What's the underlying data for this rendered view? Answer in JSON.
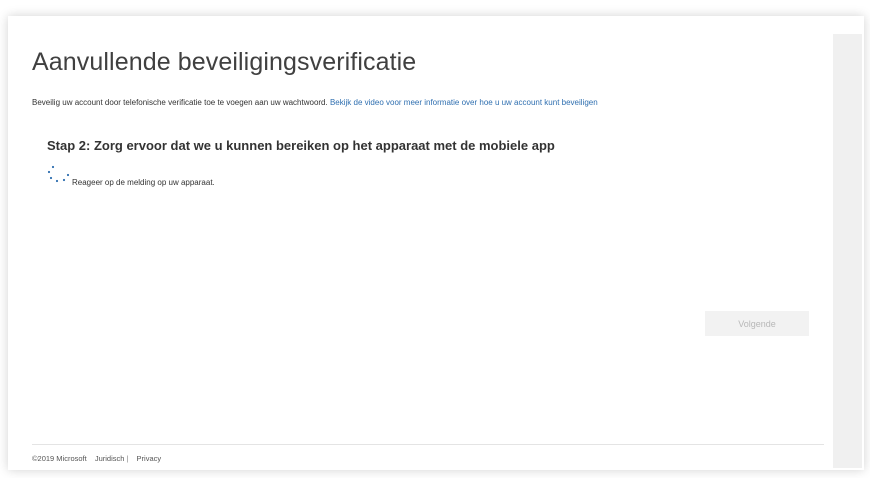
{
  "page": {
    "title": "Aanvullende beveiligingsverificatie",
    "subtitle_text": "Beveilig uw account door telefonische verificatie toe te voegen aan uw wachtwoord.",
    "subtitle_link": "Bekijk de video voor meer informatie over hoe u uw account kunt beveiligen",
    "step_heading": "Stap 2: Zorg ervoor dat we u kunnen bereiken op het apparaat met de mobiele app",
    "notification_text": "Reageer op de melding op uw apparaat.",
    "next_button": "Volgende"
  },
  "footer": {
    "copyright": "©2019 Microsoft",
    "legal_link": "Juridisch",
    "separator": "|",
    "privacy_link": "Privacy"
  },
  "colors": {
    "link": "#2f6fb0",
    "spinner": "#2f6fb0",
    "button_bg": "#f2f2f2"
  },
  "icons": {
    "spinner": "loading-spinner-icon"
  }
}
